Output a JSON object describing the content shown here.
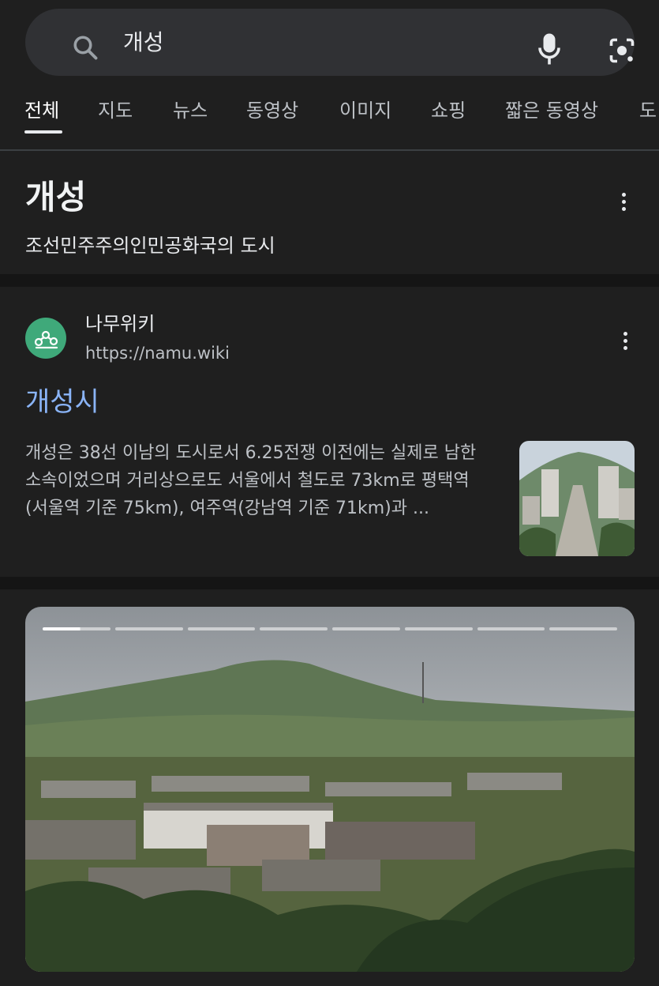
{
  "search": {
    "query": "개성"
  },
  "tabs": [
    {
      "label": "전체",
      "active": true
    },
    {
      "label": "지도"
    },
    {
      "label": "뉴스"
    },
    {
      "label": "동영상"
    },
    {
      "label": "이미지"
    },
    {
      "label": "쇼핑"
    },
    {
      "label": "짧은 동영상"
    },
    {
      "label": "도"
    }
  ],
  "knowledge": {
    "title": "개성",
    "subtitle": "조선민주주의인민공화국의 도시"
  },
  "result": {
    "site_name": "나무위키",
    "site_url": "https://namu.wiki",
    "title": "개성시",
    "snippet": "개성은 38선 이남의 도시로서 6.25전쟁 이전에는 실제로 남한 소속이었으며 거리상으로도 서울에서 철도로 73km로 평택역(서울역 기준 75km), 여주역(강남역 기준 71km)과 ..."
  },
  "story": {
    "segments": 8,
    "current_segment": 1
  },
  "colors": {
    "background": "#1f1f1f",
    "link": "#8ab4f8",
    "favicon": "#3fa97a"
  }
}
